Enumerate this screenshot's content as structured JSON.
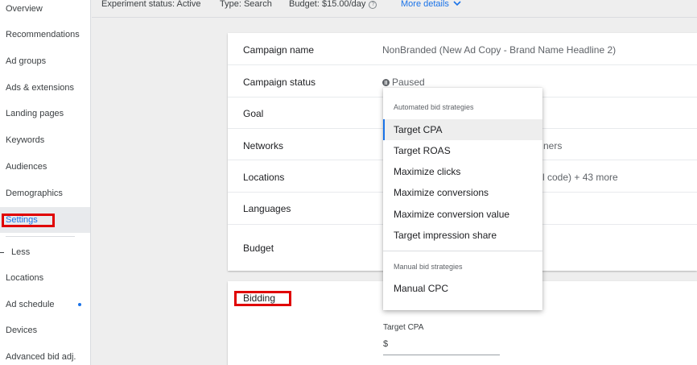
{
  "topbar": {
    "experiment_status": "Experiment status: Active",
    "type": "Type: Search",
    "budget": "Budget: $15.00/day",
    "help_glyph": "?",
    "more_details": "More details",
    "chevron": "⌄"
  },
  "sidebar": {
    "items": [
      {
        "label": "Overview"
      },
      {
        "label": "Recommendations"
      },
      {
        "label": "Ad groups"
      },
      {
        "label": "Ads & extensions"
      },
      {
        "label": "Landing pages"
      },
      {
        "label": "Keywords"
      },
      {
        "label": "Audiences"
      },
      {
        "label": "Demographics"
      },
      {
        "label": "Settings"
      },
      {
        "label": "Less"
      },
      {
        "label": "Locations"
      },
      {
        "label": "Ad schedule"
      },
      {
        "label": "Devices"
      },
      {
        "label": "Advanced bid adj."
      }
    ],
    "active_item": "Settings",
    "accent_color": "#1a73e8",
    "highlight_color": "#e00000"
  },
  "settings": {
    "rows": [
      {
        "label": "Campaign name",
        "value": "NonBranded (New Ad Copy - Brand Name Headline 2)"
      },
      {
        "label": "Campaign status",
        "value": "Paused"
      },
      {
        "label": "Goal",
        "value": ""
      },
      {
        "label": "Networks",
        "value": "ners"
      },
      {
        "label": "Locations",
        "value": "l code) + 43 more"
      },
      {
        "label": "Languages",
        "value": ""
      },
      {
        "label": "Budget",
        "value": ""
      }
    ]
  },
  "bidding": {
    "label": "Bidding",
    "target_cpa_label": "Target CPA",
    "target_cpa_value": "$"
  },
  "bid_menu": {
    "automated_header": "Automated bid strategies",
    "automated": [
      {
        "label": "Target CPA",
        "selected": true
      },
      {
        "label": "Target ROAS"
      },
      {
        "label": "Maximize clicks"
      },
      {
        "label": "Maximize conversions"
      },
      {
        "label": "Maximize conversion value"
      },
      {
        "label": "Target impression share"
      }
    ],
    "manual_header": "Manual bid strategies",
    "manual": [
      {
        "label": "Manual CPC"
      }
    ]
  }
}
